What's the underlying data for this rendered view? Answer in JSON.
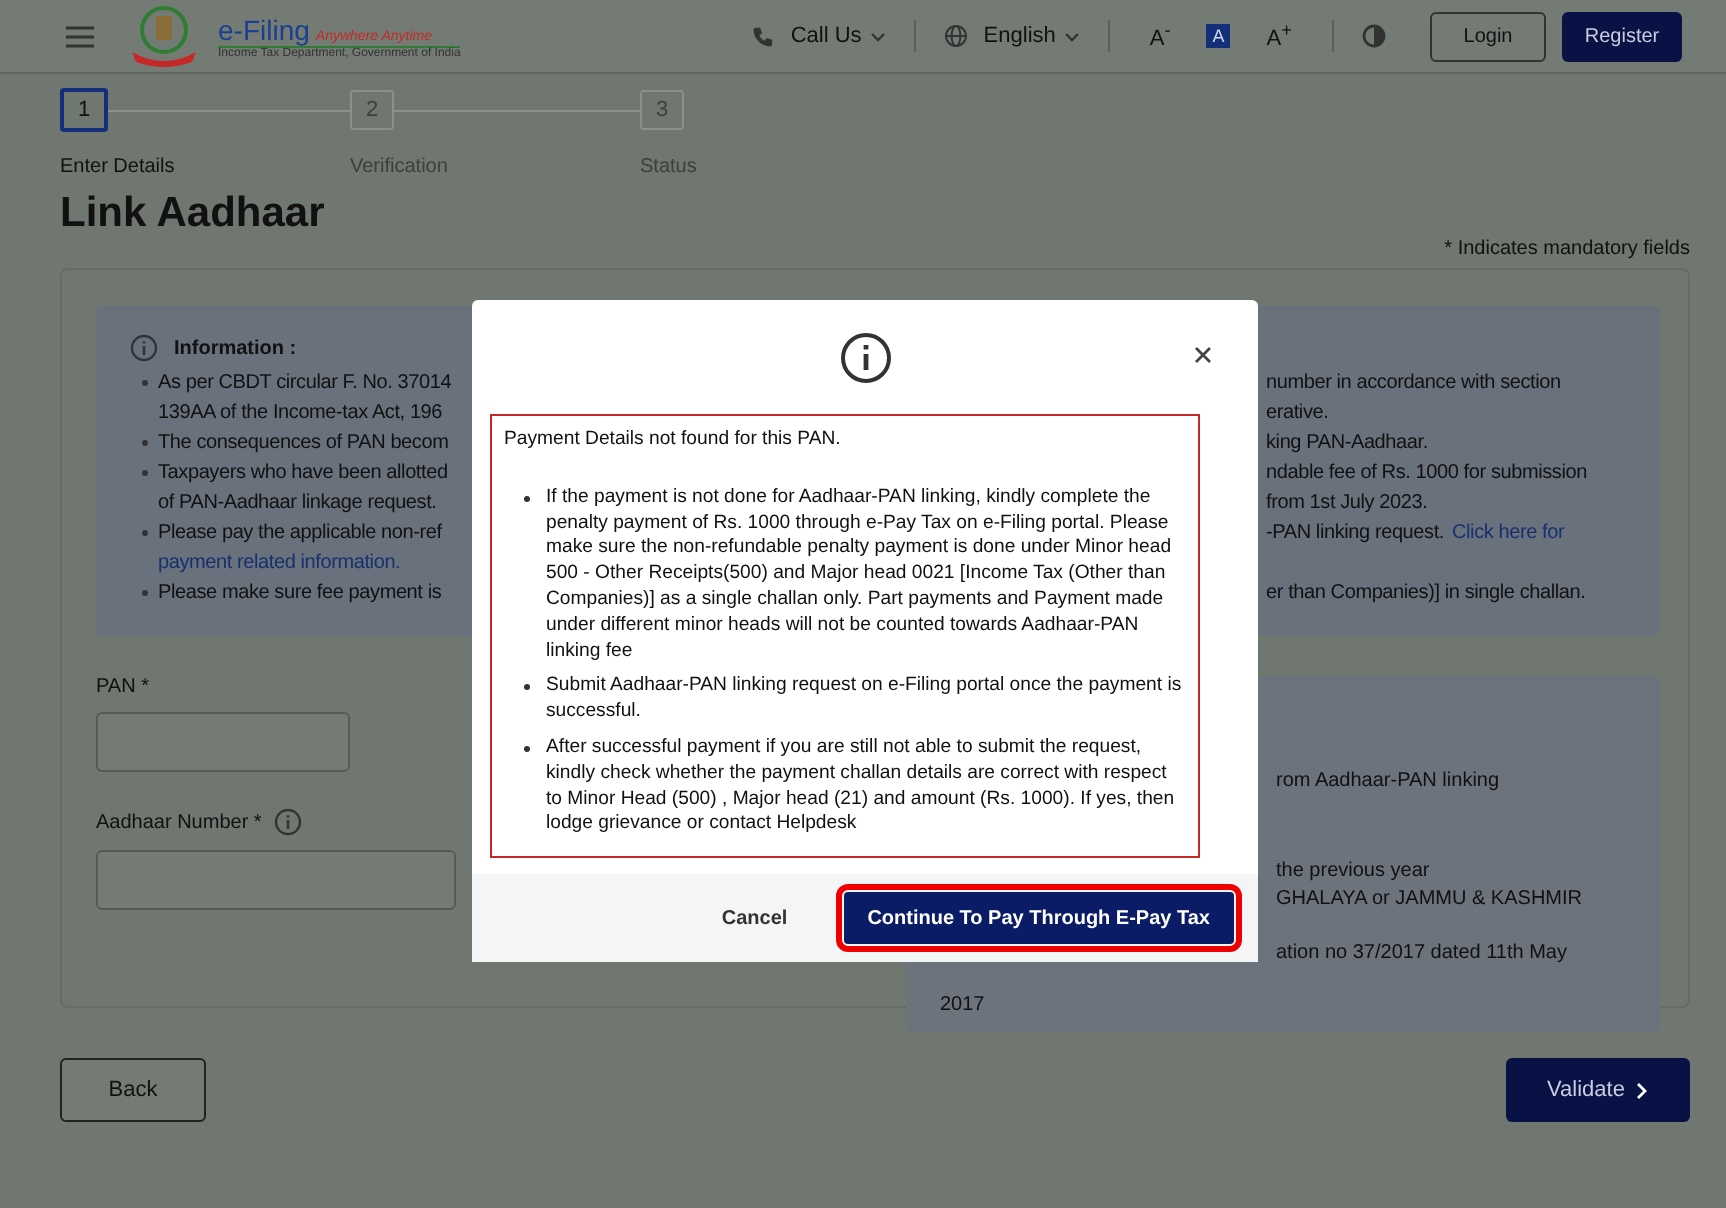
{
  "header": {
    "brand": {
      "title": "e-Filing",
      "tagline": "Anywhere Anytime",
      "subtitle": "Income Tax Department, Government of India"
    },
    "call_us": "Call Us",
    "language": "English",
    "font_sizes": [
      {
        "label": "A$^{-}$",
        "selected": false
      },
      {
        "label": "A",
        "selected": true
      },
      {
        "label": "A$^{+}$",
        "selected": false
      }
    ],
    "login": "Login",
    "register": "Register"
  },
  "steps": [
    {
      "number": "1",
      "label": "Enter Details",
      "selected": true
    },
    {
      "number": "2",
      "label": "Verification",
      "selected": false
    },
    {
      "number": "3",
      "label": "Status",
      "selected": false
    }
  ],
  "page_title": "Link Aadhaar",
  "mandatory_note": "* Indicates mandatory fields",
  "info": {
    "title": "Information :",
    "lines": [
      {
        "bullet": true,
        "left": "As per CBDT circular F. No. 37014",
        "left_is_link": false,
        "right": "number in accordance with section"
      },
      {
        "bullet": false,
        "left": "139AA of the Income-tax Act, 196",
        "left_is_link": false,
        "right": "erative."
      },
      {
        "bullet": true,
        "left": "The consequences of PAN becom",
        "left_is_link": false,
        "right": "king PAN-Aadhaar."
      },
      {
        "bullet": true,
        "left": "Taxpayers who have been allotted",
        "left_is_link": false,
        "right": "ndable fee of Rs. 1000 for submission"
      },
      {
        "bullet": false,
        "left": "of PAN-Aadhaar linkage request.",
        "left_is_link": false,
        "right": "from 1st July 2023."
      },
      {
        "bullet": true,
        "left": "Please pay the applicable non-ref",
        "left_is_link": false,
        "right": "-PAN linking request.",
        "right_link": "Click here for"
      },
      {
        "bullet": false,
        "left": "payment related information.",
        "left_is_link": true
      },
      {
        "bullet": true,
        "left": "Please make sure fee payment is",
        "left_is_link": false,
        "right": "er than Companies)] in single challan."
      }
    ]
  },
  "form": {
    "pan_label": "PAN *",
    "aadhaar_label": "Aadhaar Number *"
  },
  "side_panel": {
    "lines": [
      {
        "text": "rom Aadhaar-PAN linking",
        "kind": "cut"
      },
      {
        "text": "the previous year",
        "kind": "cut"
      },
      {
        "text": "GHALAYA or JAMMU & KASHMIR",
        "kind": "cut"
      },
      {
        "text": "ation no 37/2017 dated 11th May",
        "kind": "cut"
      },
      {
        "text": "2017",
        "kind": "full"
      }
    ]
  },
  "modal": {
    "message": "Payment Details not found for this PAN.",
    "points": [
      "If the payment is not done for Aadhaar-PAN linking, kindly complete the penalty payment of Rs. 1000 through e-Pay Tax on e-Filing portal. Please make sure the non-refundable penalty payment is done under Minor head 500 - Other Receipts(500) and Major head 0021 [Income Tax (Other than Companies)] as a single challan only. Part payments and Payment made under different minor heads will not be counted towards Aadhaar-PAN linking fee",
      "Submit Aadhaar-PAN linking request on e-Filing portal once the payment is successful.",
      "After successful payment if you are still not able to submit the request, kindly check whether the payment challan details are correct with respect to Minor Head (500) , Major head (21) and amount (Rs. 1000). If yes, then lodge grievance or contact Helpdesk"
    ],
    "cancel": "Cancel",
    "confirm": {
      "label": "Continue To Pay Through E-Pay Tax",
      "highlighted": true
    }
  },
  "footer": {
    "back": "Back",
    "validate": "Validate"
  }
}
